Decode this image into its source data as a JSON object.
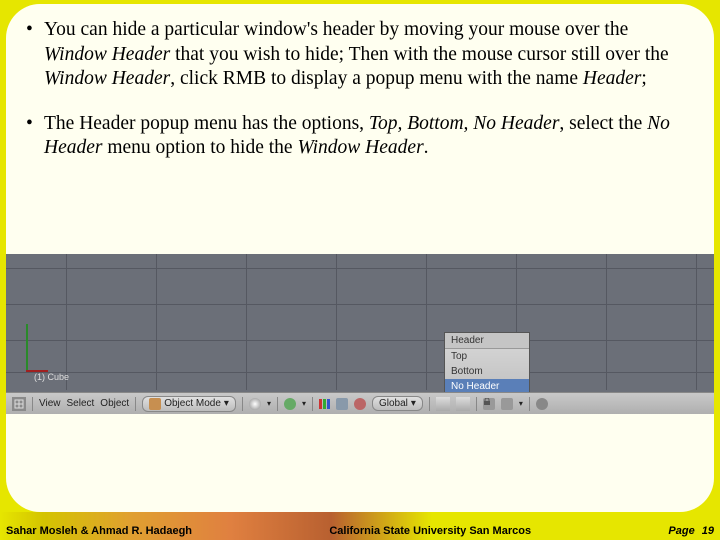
{
  "bullets": [
    {
      "pre": "You can hide a particular window's header by moving your mouse over the ",
      "i1": "Window Header",
      "mid1": " that you wish to hide; Then with the mouse cursor still over the ",
      "i2": "Window Header",
      "mid2": ", click RMB to display a popup menu with the name ",
      "i3": "Header",
      "post": ";"
    },
    {
      "pre": "The Header popup menu has the options, ",
      "i1": "Top, Bottom, No Header",
      "mid1": ", select the ",
      "i2": "No Header",
      "mid2": " menu option to hide the ",
      "i3": "Window Header",
      "post": "."
    }
  ],
  "popup": {
    "title": "Header",
    "items": [
      "Top",
      "Bottom",
      "No Header"
    ],
    "selected": "No Header"
  },
  "headerbar": {
    "axis_label": "(1) Cube",
    "menus": [
      "View",
      "Select",
      "Object"
    ],
    "mode": "Object Mode",
    "orient": "Global"
  },
  "footer": {
    "left": "Sahar Mosleh & Ahmad R. Hadaegh",
    "center": "California State University San Marcos",
    "page_label": "Page",
    "page_num": "19"
  }
}
